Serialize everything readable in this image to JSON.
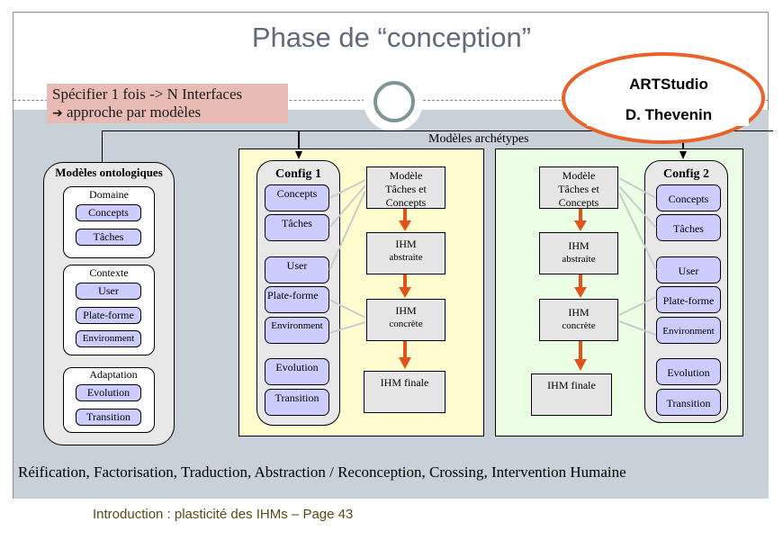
{
  "slide": {
    "title": "Phase de “conception”",
    "spec_box": {
      "line1": "Spécifier 1 fois ->  N Interfaces",
      "line2_arrow": "➔",
      "line2": "approche par modèles"
    },
    "callout": {
      "line1": "ARTStudio",
      "line2": "D. Thevenin"
    },
    "archetypes_label": "Modèles archétypes",
    "ontological": {
      "title": "Modèles ontologiques",
      "groups": [
        {
          "label": "Domaine",
          "items": [
            "Concepts",
            "Tâches"
          ]
        },
        {
          "label": "Contexte",
          "items": [
            "User",
            "Plate-forme",
            "Environment"
          ]
        },
        {
          "label": "Adaptation",
          "items": [
            "Evolution",
            "Transition"
          ]
        }
      ]
    },
    "config1": {
      "title": "Config 1",
      "items": [
        "Concepts",
        "Tâches",
        "User",
        "Plate-forme",
        "Environment",
        "Evolution",
        "Transition"
      ]
    },
    "config2": {
      "title": "Config 2",
      "items": [
        "Concepts",
        "Tâches",
        "User",
        "Plate-forme",
        "Environment",
        "Evolution",
        "Transition"
      ]
    },
    "pipeline1": {
      "boxes": [
        {
          "line1": "Modèle",
          "line2": "Tâches et",
          "line3": "Concepts"
        },
        {
          "line1": "IHM",
          "line2": "abstraite"
        },
        {
          "line1": "IHM",
          "line2": "concrète"
        },
        {
          "line1": "IHM finale"
        }
      ]
    },
    "pipeline2": {
      "boxes": [
        {
          "line1": "Modèle",
          "line2": "Tâches et",
          "line3": "Concepts"
        },
        {
          "line1": "IHM",
          "line2": "abstraite"
        },
        {
          "line1": "IHM",
          "line2": "concrète"
        },
        {
          "line1": "IHM finale"
        }
      ]
    },
    "bottom_text": "Réification, Factorisation, Traduction, Abstraction / Reconception, Crossing, Intervention Humaine",
    "footer": "Introduction : plasticité des IHMs  – Page 43",
    "colors": {
      "title": "#5f6b7c",
      "band": "#c7d1d7",
      "spec_box": "#e8bcb4",
      "callout_ring": "#e8622a",
      "pill": "#ccccff",
      "panel_yellow": "#fffdd0",
      "panel_green": "#eaffe4",
      "model_box": "#e6e6e6",
      "pipeline_arrow": "#e0541c",
      "connector": "#c8cccc",
      "footer": "#5c4a12"
    }
  }
}
